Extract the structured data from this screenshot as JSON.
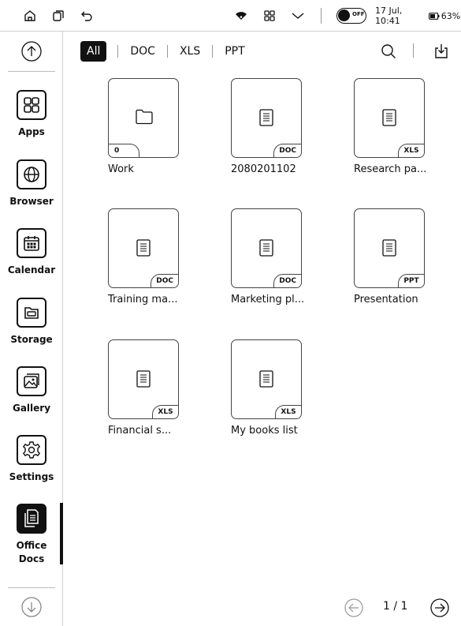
{
  "status_bar": {
    "home_icon": "home-icon",
    "multitask_icon": "multitask-icon",
    "back_icon": "back-icon",
    "wifi_icon": "wifi-icon",
    "apps_grid_icon": "apps-grid-icon",
    "dropdown_icon": "chevron-down-icon",
    "toggle_label": "OFF",
    "datetime": "17 Jul, 10:41",
    "battery": "63%"
  },
  "sidebar": {
    "items": [
      {
        "label": "Apps",
        "icon": "apps-icon"
      },
      {
        "label": "Browser",
        "icon": "globe-icon"
      },
      {
        "label": "Calendar",
        "icon": "calendar-icon"
      },
      {
        "label": "Storage",
        "icon": "storage-icon"
      },
      {
        "label": "Gallery",
        "icon": "gallery-icon"
      },
      {
        "label": "Settings",
        "icon": "gear-icon"
      },
      {
        "label_line1": "Office",
        "label_line2": "Docs",
        "icon": "office-docs-icon",
        "active": true
      }
    ]
  },
  "tabs": [
    {
      "label": "All",
      "active": true
    },
    {
      "label": "DOC"
    },
    {
      "label": "XLS"
    },
    {
      "label": "PPT"
    }
  ],
  "files": [
    {
      "name": "Work",
      "tag": "0",
      "kind": "folder"
    },
    {
      "name": "2080201102",
      "tag": "DOC",
      "kind": "doc"
    },
    {
      "name": "Research pa...",
      "tag": "XLS",
      "kind": "doc"
    },
    {
      "name": "Training ma...",
      "tag": "DOC",
      "kind": "doc"
    },
    {
      "name": "Marketing pl...",
      "tag": "DOC",
      "kind": "doc"
    },
    {
      "name": "Presentation",
      "tag": "PPT",
      "kind": "doc"
    },
    {
      "name": "Financial s...",
      "tag": "XLS",
      "kind": "doc"
    },
    {
      "name": "My books list",
      "tag": "XLS",
      "kind": "doc"
    }
  ],
  "pagination": {
    "text": "1 / 1"
  }
}
